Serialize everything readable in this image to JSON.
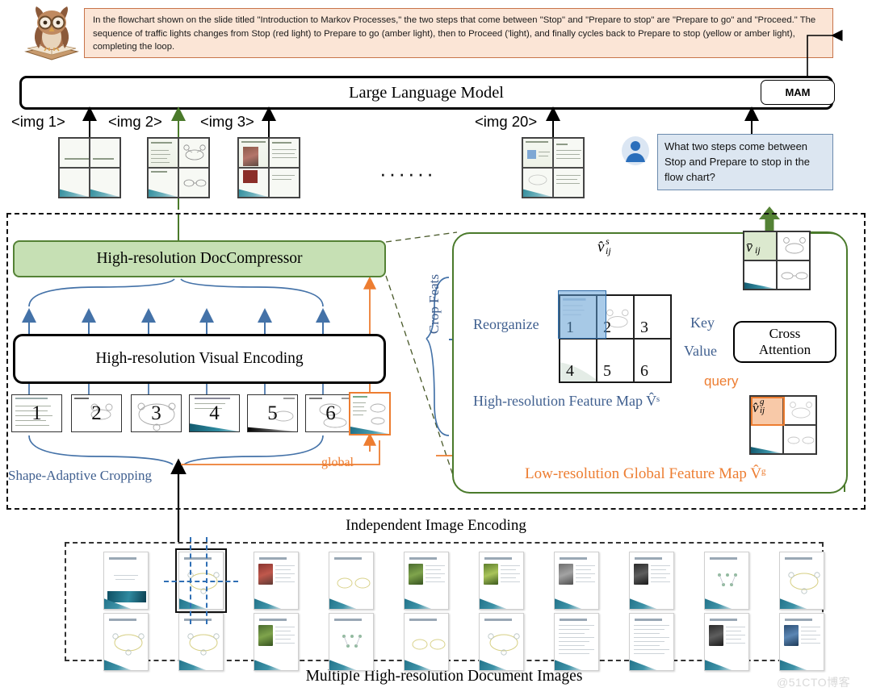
{
  "answer": {
    "text": "In the flowchart shown on the slide titled \"Introduction to Markov Processes,\" the two steps that come between \"Stop\" and \"Prepare to stop\" are \"Prepare to go\" and \"Proceed.\" The sequence of traffic lights changes from Stop (red light) to Prepare to go (amber light), then to Proceed ('light), and finally cycles back to Prepare to stop (yellow or amber light), completing the loop.",
    "bg_color": "#fbe5d6",
    "border_color": "#c8744a"
  },
  "owl": {
    "icon": "owl-reading-book-icon"
  },
  "llm": {
    "title": "Large Language Model",
    "mam_label": "MAM"
  },
  "image_tokens": [
    {
      "label": "<img 1>"
    },
    {
      "label": "<img 2>"
    },
    {
      "label": "<img 3>"
    },
    {
      "label": "<img 20>"
    }
  ],
  "ellipsis": "······",
  "question": {
    "text": "What two steps come between Stop and Prepare to stop in the flow chart?",
    "bg_color": "#dce6f1",
    "border_color": "#6b8aad",
    "avatar_icon": "user-avatar-icon"
  },
  "encoding": {
    "caption": "Independent Image Encoding",
    "doccompressor": "High-resolution DocCompressor",
    "doccompressor_color": "#c6e0b4",
    "doccompressor_border": "#548235",
    "visual_encoding": "High-resolution Visual Encoding",
    "crop_labels": [
      "1",
      "2",
      "3",
      "4",
      "5",
      "6"
    ],
    "global_label": "global",
    "global_color": "#ed7d31",
    "shape_adaptive_label": "Shape-Adaptive Cropping",
    "label_blue": "#3f5f8f"
  },
  "detail": {
    "panel_border": "#4a7a2b",
    "crop_feats": "Crop Feats",
    "reorganize": "Reorganize",
    "vhat_s": "v̂ᵢⱼˢ",
    "vhat_s_parts": {
      "base": "v",
      "sub": "ij",
      "sup": "s"
    },
    "feature_map_numbers": [
      "1",
      "2",
      "3",
      "4",
      "5",
      "6"
    ],
    "feature_map_caption": "High-resolution Feature Map V̂ˢ",
    "global_feature_caption": "Low-resolution Global Feature Map V̂ᵍ",
    "key": "Key",
    "value": "Value",
    "query": "query",
    "cross_attention_line1": "Cross",
    "cross_attention_line2": "Attention",
    "vbar_label": "v̄ᵢⱼ",
    "vhat_g_label": "v̂ᵢⱼᵍ"
  },
  "documents": {
    "caption": "Multiple High-resolution Document Images",
    "row1_count": 10,
    "row2_count": 10,
    "selected_index": 1
  },
  "watermark": "@51CTO博客"
}
